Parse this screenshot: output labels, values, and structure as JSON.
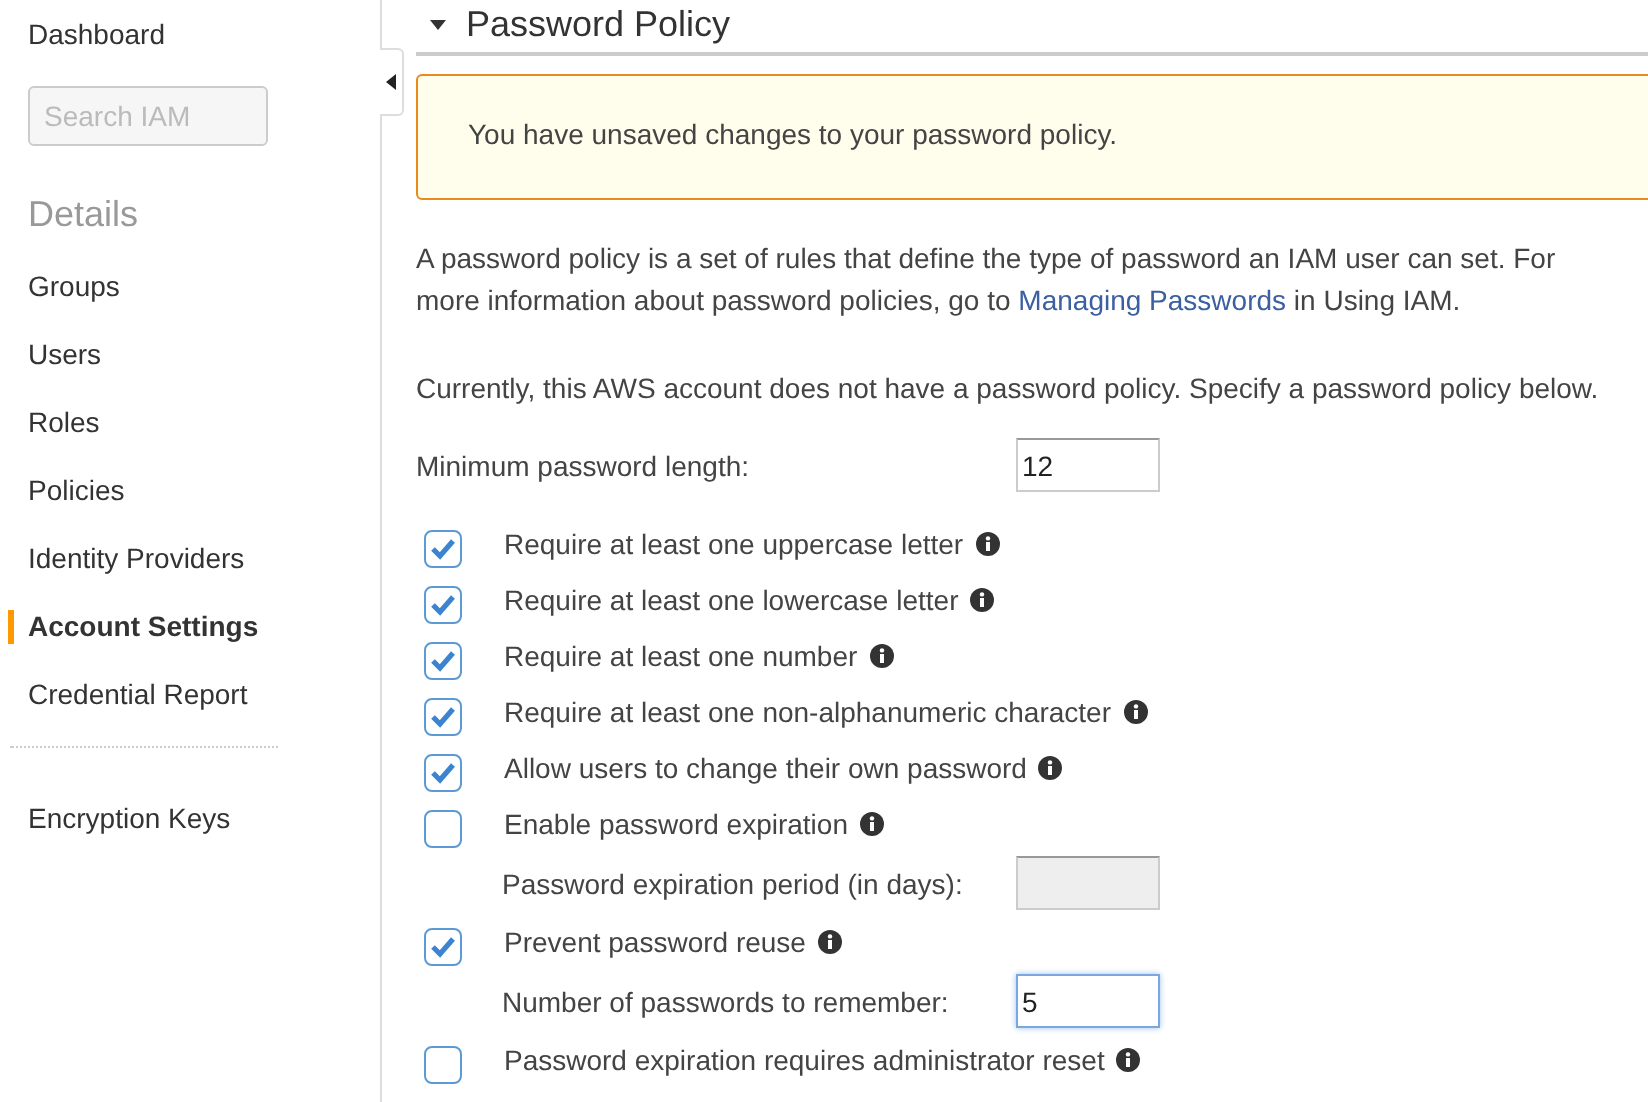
{
  "sidebar": {
    "top_item": {
      "label": "Dashboard",
      "selected": false
    },
    "search": {
      "placeholder": "Search IAM"
    },
    "section_heading": "Details",
    "items": [
      {
        "label": "Groups",
        "selected": false
      },
      {
        "label": "Users",
        "selected": false
      },
      {
        "label": "Roles",
        "selected": false
      },
      {
        "label": "Policies",
        "selected": false
      },
      {
        "label": "Identity Providers",
        "selected": false
      },
      {
        "label": "Account Settings",
        "selected": true
      },
      {
        "label": "Credential Report",
        "selected": false
      }
    ],
    "bottom_items": [
      {
        "label": "Encryption Keys",
        "selected": false
      }
    ]
  },
  "section": {
    "title": "Password Policy",
    "expanded": true
  },
  "alert": "You have unsaved changes to your password policy.",
  "intro": {
    "text": "A password policy is a set of rules that define the type of password an IAM user can set. For more information about password policies, go to ",
    "link": "Managing Passwords",
    "suffix": " in Using IAM."
  },
  "notice": "Currently, this AWS account does not have a password policy. Specify a password policy below.",
  "min_length": {
    "label": "Minimum password length:",
    "value": "12"
  },
  "options": [
    {
      "kind": "checkbox",
      "label": "Require at least one uppercase letter",
      "checked": true
    },
    {
      "kind": "checkbox",
      "label": "Require at least one lowercase letter",
      "checked": true
    },
    {
      "kind": "checkbox",
      "label": "Require at least one number",
      "checked": true
    },
    {
      "kind": "checkbox",
      "label": "Require at least one non-alphanumeric character",
      "checked": true
    },
    {
      "kind": "checkbox",
      "label": "Allow users to change their own password",
      "checked": true
    },
    {
      "kind": "checkbox",
      "label": "Enable password expiration",
      "checked": false
    },
    {
      "kind": "field",
      "label": "Password expiration period (in days):",
      "disabled": true,
      "focused": false
    },
    {
      "kind": "checkbox",
      "label": "Prevent password reuse",
      "checked": true
    },
    {
      "kind": "field",
      "label": "Number of passwords to remember:",
      "value": "5",
      "disabled": false,
      "focused": true
    },
    {
      "kind": "checkbox",
      "label": "Password expiration requires administrator reset",
      "checked": false
    }
  ]
}
